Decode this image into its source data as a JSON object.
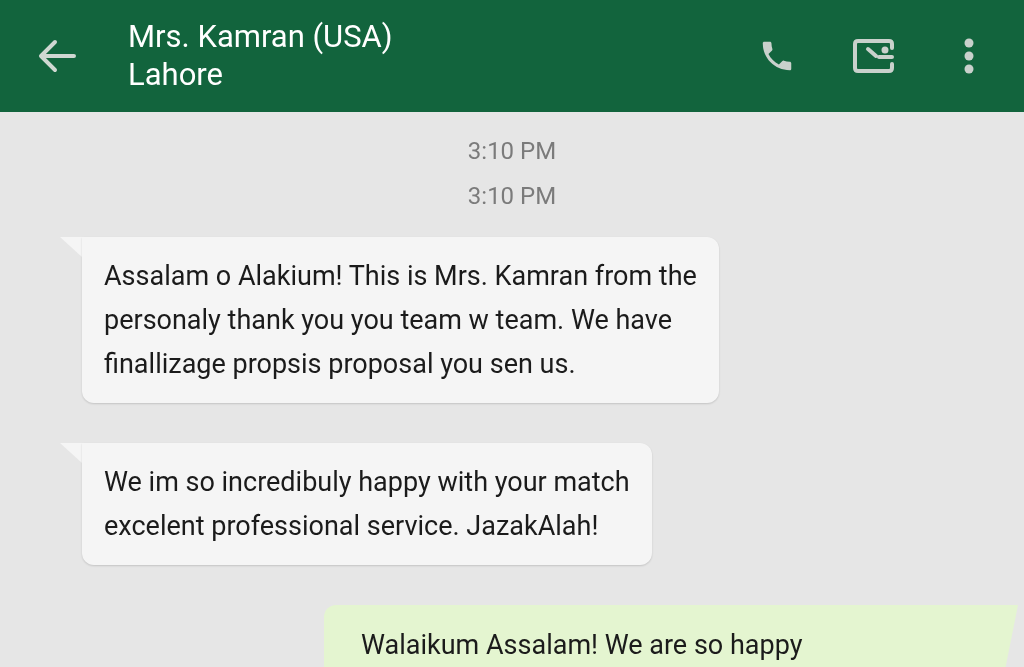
{
  "header": {
    "title": "Mrs. Kamran (USA)",
    "subtitle": "Lahore"
  },
  "timestamps": [
    "3:10 PM",
    "3:10 PM"
  ],
  "messages": [
    {
      "kind": "incoming",
      "text": "Assalam o Alakium! This is Mrs. Kamran from the\npersonaly thank you you team w team. We have\nfinallizage propsis proposal you sen us."
    },
    {
      "kind": "incoming",
      "text": "We im so incredibuly happy with your match\nexcelent professional service. JazakAlah!"
    },
    {
      "kind": "outgoing",
      "text": "Walaikum Assalam! We are so happy"
    }
  ]
}
